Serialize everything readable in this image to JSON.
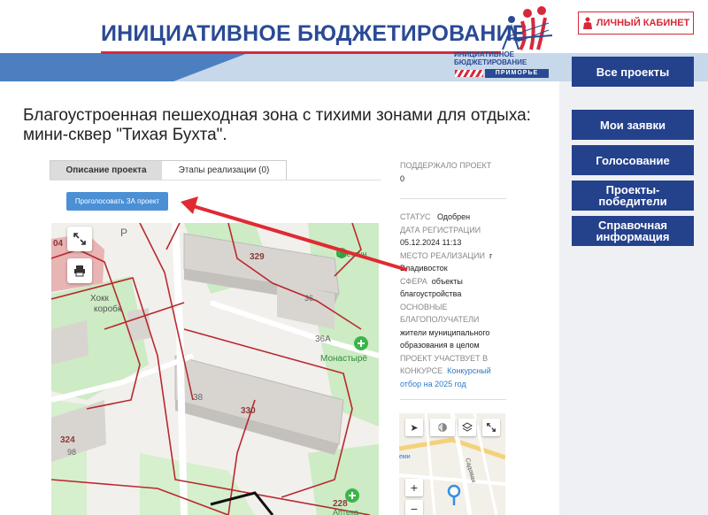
{
  "header": {
    "site_title": "ИНИЦИАТИВНОЕ БЮДЖЕТИРОВАНИЕ",
    "logo_line1": "ИНИЦИАТИВНОЕ",
    "logo_line2": "БЮДЖЕТИРОВАНИЕ",
    "logo_region": "ПРИМОРЬЕ",
    "cabinet_label": "ЛИЧНЫЙ КАБИНЕТ"
  },
  "sidebar": {
    "items": [
      {
        "label": "Все проекты"
      },
      {
        "label": "Мои заявки"
      },
      {
        "label": "Голосование"
      },
      {
        "label": "Проекты-победители"
      },
      {
        "label": "Справочная информация"
      }
    ]
  },
  "project": {
    "title": "Благоустроенная пешеходная зона с тихими зонами для отдыха: мини-сквер \"Тихая Бухта\".",
    "tabs": [
      {
        "label": "Описание проекта",
        "active": true
      },
      {
        "label": "Этапы реализации (0)",
        "active": false
      }
    ],
    "vote_label": "Проголосовать ЗА проект"
  },
  "info": {
    "supported_label": "ПОДДЕРЖАЛО ПРОЕКТ",
    "supported_value": "0",
    "status_label": "СТАТУС",
    "status_value": "Одобрен",
    "reg_date_label": "ДАТА РЕГИСТРАЦИИ",
    "reg_date_value": "05.12.2024 11:13",
    "place_label": "МЕСТО РЕАЛИЗАЦИИ",
    "place_value": "г Владивосток",
    "sphere_label": "СФЕРА",
    "sphere_value": "объекты благоустройства",
    "beneficiaries_label": "ОСНОВНЫЕ БЛАГОПОЛУЧАТЕЛИ",
    "beneficiaries_value": "жители муниципального образования в целом",
    "contest_label": "ПРОЕКТ УЧАСТВУЕТ В КОНКУРСЕ",
    "contest_value": "Конкурсный отбор на 2025 год"
  },
  "map": {
    "labels": {
      "b329": "329",
      "b36": "36",
      "b36a": "36А",
      "b38": "38",
      "b330": "330",
      "b324": "324",
      "b98": "98",
      "b228": "228",
      "b04": "04",
      "p": "Р",
      "monastyr": "Монастырё",
      "hokk": "Хокк",
      "korobk": "коробк",
      "tsvetoch": "Цветочн",
      "apteka": "Аптека"
    },
    "small_labels": {
      "sad": "Садовая",
      "emi": "еми"
    }
  },
  "colors": {
    "brand_blue": "#24418c",
    "brand_red": "#d6293a",
    "vote_blue": "#4b8fd4",
    "arrow_red": "#e02a32"
  }
}
